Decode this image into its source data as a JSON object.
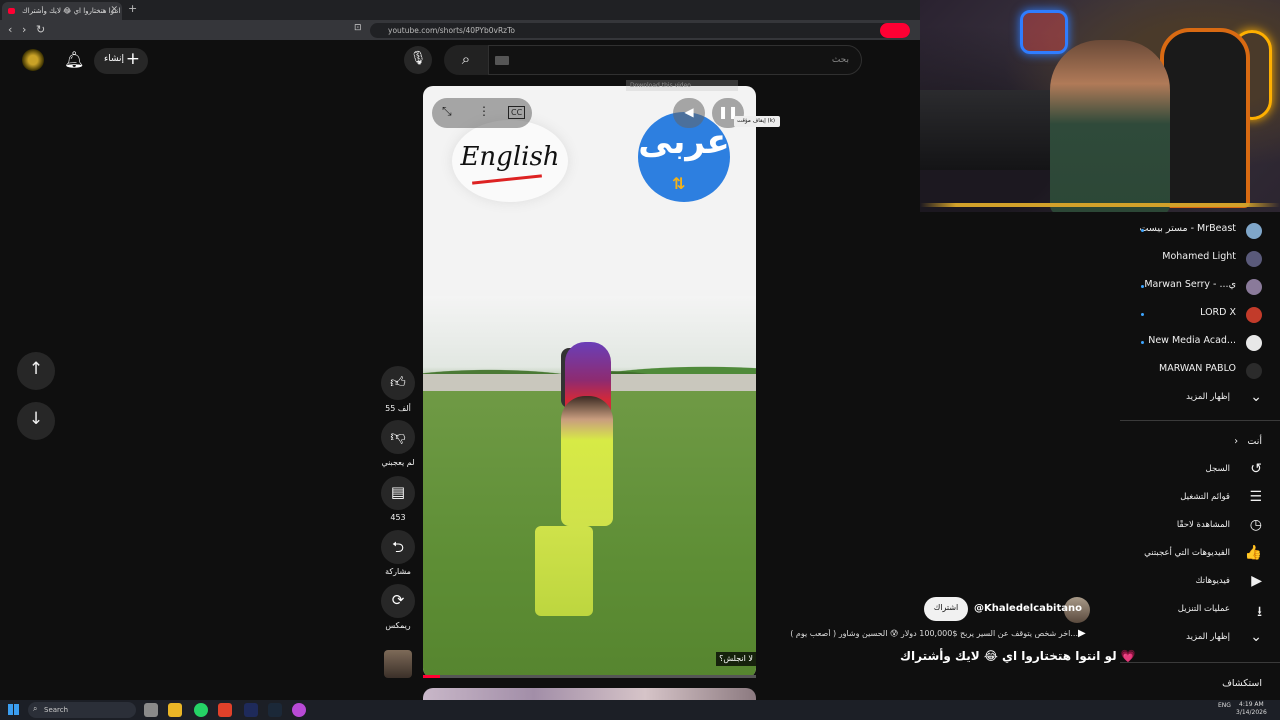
{
  "browser": {
    "tab_title": "لو انتوا هتختاروا اي 😂 لايك وأشتراك",
    "new_tab": "+",
    "url": "youtube.com/shorts/40PYb0vRzTo"
  },
  "header": {
    "create_label": "إنشاء",
    "search_placeholder": "بحث"
  },
  "video": {
    "english_card": "English",
    "arabic_card": "عربى",
    "caption_tag": "لا انجلش؟",
    "tooltip": "إيقاف مؤقت (k)",
    "download_hint": "Download this video"
  },
  "actions": {
    "like_count": "55 ألف",
    "dislike_label": "لم يعجبني",
    "comment_count": "453",
    "share_label": "مشاركة",
    "remix_label": "ريمكس"
  },
  "description": {
    "handle": "@Khaledelcabitano",
    "subscribe_label": "اشتراك",
    "related_line": "اخر شخص يتوقف عن السير يربح $100,000 دولار 😰 الحسين وشاور ( أصعب يوم )...",
    "title": "لو انتوا هتختاروا اي 😂 لايك وأشتراك 💗"
  },
  "sidebar": {
    "subscriptions": [
      {
        "name": "مستر بيست - MrBeast",
        "color": "#7fa6c9",
        "dot": true
      },
      {
        "name": "Mohamed Light",
        "color": "#5a5a7a",
        "dot": false
      },
      {
        "name": "Marwan Serry - ...ي",
        "color": "#8a7a9a",
        "dot": true
      },
      {
        "name": "LORD X",
        "color": "#c23b2a",
        "dot": true
      },
      {
        "name": "New Media Acad...",
        "color": "#e8e8e8",
        "dot": true
      },
      {
        "name": "MARWAN PABLO",
        "color": "#2b2b2b",
        "dot": false
      }
    ],
    "show_more": "إظهار المزيد",
    "you_header": "أنت",
    "you_items": [
      {
        "label": "السجل",
        "icon": "history-icon",
        "glyph": "↺"
      },
      {
        "label": "قوائم التشغيل",
        "icon": "playlists-icon",
        "glyph": "☰"
      },
      {
        "label": "المشاهدة لاحقًا",
        "icon": "watch-later-icon",
        "glyph": "◷"
      },
      {
        "label": "الفيديوهات التي أعجبتني",
        "icon": "like-icon",
        "glyph": "👍"
      },
      {
        "label": "فيديوهاتك",
        "icon": "your-videos-icon",
        "glyph": "▶"
      },
      {
        "label": "عمليات التنزيل",
        "icon": "download-icon",
        "glyph": "⭳"
      },
      {
        "label": "إظهار المزيد",
        "icon": "chevron-down-icon",
        "glyph": "⌄"
      }
    ],
    "explore_header": "استكشاف"
  },
  "taskbar": {
    "search": "Search",
    "lang": "ENG",
    "time": "4:19 AM",
    "date": "3/14/2026"
  }
}
